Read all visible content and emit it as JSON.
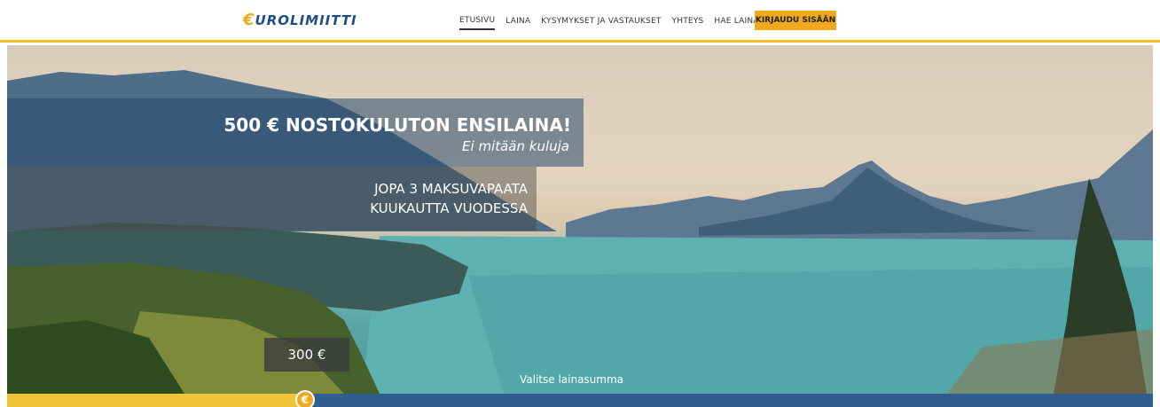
{
  "brand": {
    "logo_prefix": "€",
    "logo_text": "UROLIMIITTI"
  },
  "nav": {
    "items": [
      {
        "label": "ETUSIVU",
        "active": true
      },
      {
        "label": "LAINA",
        "active": false
      },
      {
        "label": "KYSYMYKSET JA VASTAUKSET",
        "active": false
      },
      {
        "label": "YHTEYS",
        "active": false
      },
      {
        "label": "HAE LAINAA",
        "active": false
      }
    ],
    "cta_label": "KIRJAUDU SISÄÄN"
  },
  "hero": {
    "headline": "500 € NOSTOKULUTON ENSILAINA!",
    "subheadline": "Ei mitään kuluja",
    "offer_line1": "JOPA 3 MAKSUVAPAATA",
    "offer_line2": "KUUKAUTTA VUODESSA"
  },
  "slider": {
    "amount_label": "300 €",
    "caption": "Valitse lainasumma",
    "thumb_icon": "euro-icon",
    "thumb_symbol": "€",
    "fill_fraction": 0.26,
    "colors": {
      "fill": "#f0c43a",
      "track": "#2f5e8f",
      "thumb": "#f0a91c"
    }
  }
}
